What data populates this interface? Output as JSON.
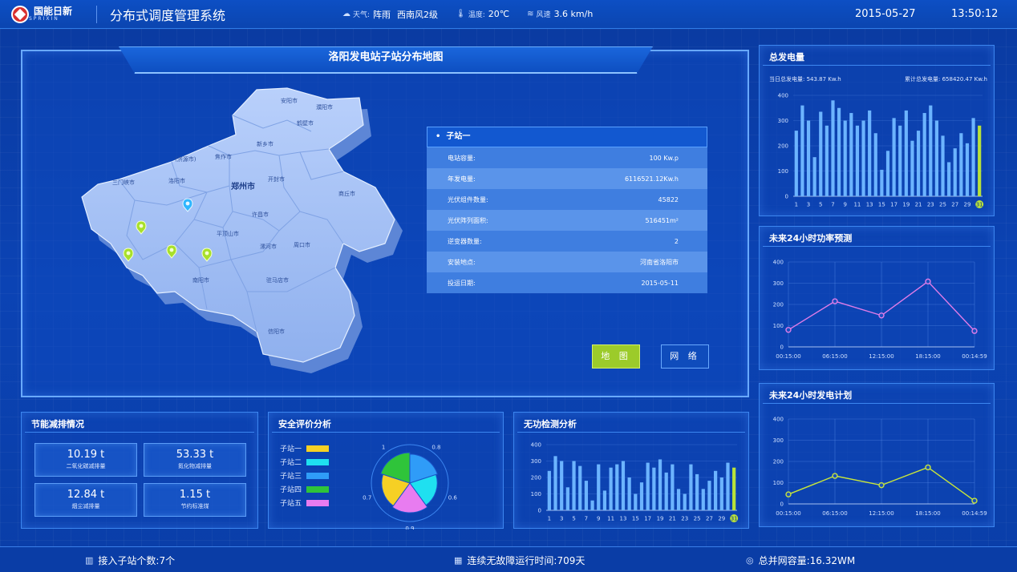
{
  "header": {
    "brand": "国能日新",
    "brand_sub": "SPRIXIN",
    "system_title": "分布式调度管理系统",
    "weather": {
      "weather_label": "天气:",
      "weather_value": "阵雨",
      "wind_dir": "西南风2级",
      "temp_label": "温度:",
      "temp_value": "20℃",
      "speed_label": "风速",
      "speed_value": "3.6 km/h"
    },
    "date": "2015-05-27",
    "time": "13:50:12"
  },
  "map": {
    "title": "洛阳发电站子站分布地图",
    "cities": [
      "安阳市",
      "鹤壁市",
      "濮阳市",
      "新乡市",
      "焦作市",
      "(济源市)",
      "三门峡市",
      "洛阳市",
      "郑州市",
      "开封市",
      "商丘市",
      "许昌市",
      "平顶山市",
      "漯河市",
      "周口市",
      "南阳市",
      "驻马店市",
      "信阳市"
    ],
    "buttons": {
      "map": "地 图",
      "network": "网 络"
    },
    "station": {
      "name": "子站一",
      "rows": [
        {
          "label": "电站容量:",
          "value": "100  Kw.p"
        },
        {
          "label": "年发电量:",
          "value": "6116521.12Kw.h"
        },
        {
          "label": "光伏组件数量:",
          "value": "45822"
        },
        {
          "label": "光伏阵列面积:",
          "value": "516451m²"
        },
        {
          "label": "逆变器数量:",
          "value": "2"
        },
        {
          "label": "安装地点:",
          "value": "河南省洛阳市"
        },
        {
          "label": "投运日期:",
          "value": "2015-05-11"
        }
      ]
    }
  },
  "total_power": {
    "title": "总发电量",
    "daily_label": "当日总发电量: 543.87  Kw.h",
    "cumulative_label": "累计总发电量: 658420.47  Kw.h"
  },
  "forecast_power": {
    "title": "未来24小时功率预测"
  },
  "forecast_plan": {
    "title": "未来24小时发电计划"
  },
  "energy": {
    "title": "节能减排情况",
    "items": [
      {
        "value": "10.19   t",
        "label": "二氧化碳减排量"
      },
      {
        "value": "53.33   t",
        "label": "氮化物减排量"
      },
      {
        "value": "12.84   t",
        "label": "烟尘减排量"
      },
      {
        "value": "1.15    t",
        "label": "节约标准煤"
      }
    ]
  },
  "safety": {
    "title": "安全评价分析",
    "legend": [
      {
        "name": "子站一",
        "color": "#f6d024"
      },
      {
        "name": "子站二",
        "color": "#1fe0f0"
      },
      {
        "name": "子站三",
        "color": "#2f9cf8"
      },
      {
        "name": "子站四",
        "color": "#2fc43a"
      },
      {
        "name": "子站五",
        "color": "#e87cf0"
      }
    ]
  },
  "reactive": {
    "title": "无功检测分析"
  },
  "chart_data": [
    {
      "type": "bar",
      "title": "总发电量",
      "categories": [
        "1",
        "2",
        "3",
        "4",
        "5",
        "6",
        "7",
        "8",
        "9",
        "10",
        "11",
        "12",
        "13",
        "14",
        "15",
        "16",
        "17",
        "18",
        "19",
        "20",
        "21",
        "22",
        "23",
        "24",
        "25",
        "26",
        "27",
        "28",
        "29",
        "30",
        "31"
      ],
      "tick_labels": [
        "1",
        "3",
        "5",
        "7",
        "9",
        "11",
        "13",
        "15",
        "17",
        "19",
        "21",
        "23",
        "25",
        "27",
        "29",
        "31"
      ],
      "values": [
        260,
        360,
        300,
        155,
        335,
        280,
        380,
        350,
        300,
        330,
        280,
        300,
        340,
        250,
        105,
        180,
        310,
        280,
        340,
        220,
        260,
        330,
        360,
        300,
        240,
        135,
        190,
        250,
        210,
        310,
        280
      ],
      "highlight_index": 30,
      "ylim": [
        0,
        400
      ],
      "yticks": [
        0,
        100,
        200,
        300,
        400
      ]
    },
    {
      "type": "line",
      "title": "未来24小时功率预测",
      "x": [
        "00:15:00",
        "06:15:00",
        "12:15:00",
        "18:15:00",
        "00:14:59"
      ],
      "values": [
        80,
        215,
        148,
        308,
        75
      ],
      "ylim": [
        0,
        400
      ],
      "yticks": [
        0,
        100,
        200,
        300,
        400
      ],
      "color": "#e07ce8"
    },
    {
      "type": "line",
      "title": "未来24小时发电计划",
      "x": [
        "00:15:00",
        "06:15:00",
        "12:15:00",
        "18:15:00",
        "00:14:59"
      ],
      "values": [
        45,
        132,
        88,
        172,
        15
      ],
      "ylim": [
        0,
        400
      ],
      "yticks": [
        0,
        100,
        200,
        300,
        400
      ],
      "color": "#c8e63a"
    },
    {
      "type": "pie",
      "title": "安全评价分析",
      "labels": [
        "子站一",
        "子站二",
        "子站三",
        "子站四",
        "子站五"
      ],
      "values": [
        0.7,
        0.6,
        0.8,
        1,
        0.9
      ],
      "value_labels": [
        "0.7",
        "0.6",
        "0.8",
        "1",
        "0.9"
      ],
      "colors": [
        "#f6d024",
        "#1fe0f0",
        "#2f9cf8",
        "#2fc43a",
        "#e87cf0"
      ]
    },
    {
      "type": "bar",
      "title": "无功检测分析",
      "categories": [
        "1",
        "2",
        "3",
        "4",
        "5",
        "6",
        "7",
        "8",
        "9",
        "10",
        "11",
        "12",
        "13",
        "14",
        "15",
        "16",
        "17",
        "18",
        "19",
        "20",
        "21",
        "22",
        "23",
        "24",
        "25",
        "26",
        "27",
        "28",
        "29",
        "30",
        "31"
      ],
      "tick_labels": [
        "1",
        "3",
        "5",
        "7",
        "9",
        "11",
        "13",
        "15",
        "17",
        "19",
        "21",
        "23",
        "25",
        "27",
        "29",
        "31"
      ],
      "values": [
        240,
        330,
        300,
        140,
        300,
        270,
        180,
        60,
        280,
        120,
        260,
        280,
        300,
        200,
        100,
        170,
        290,
        260,
        310,
        230,
        280,
        130,
        100,
        280,
        220,
        130,
        180,
        240,
        200,
        290,
        260
      ],
      "highlight_index": 30,
      "ylim": [
        0,
        400
      ],
      "yticks": [
        0,
        100,
        200,
        300,
        400
      ]
    }
  ],
  "footer": {
    "substations": "接入子站个数:7个",
    "uptime": "连续无故障运行时间:709天",
    "capacity": "总并网容量:16.32WM"
  }
}
